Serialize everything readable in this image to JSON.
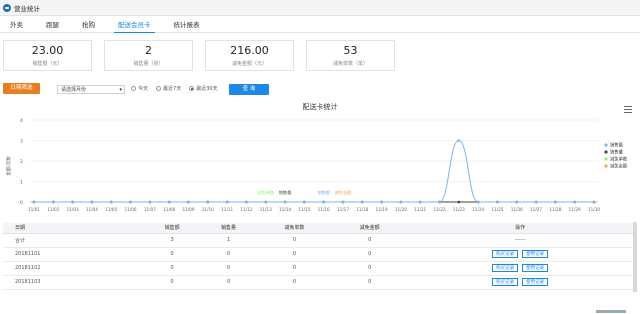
{
  "app": {
    "title": "营业统计"
  },
  "tabs": [
    {
      "label": "外卖"
    },
    {
      "label": "跑腿"
    },
    {
      "label": "抢购"
    },
    {
      "label": "配送会员卡",
      "active": true
    },
    {
      "label": "统计报表"
    }
  ],
  "cards": [
    {
      "value": "23.00",
      "label": "销售额（元）"
    },
    {
      "value": "2",
      "label": "销售量（张）"
    },
    {
      "value": "216.00",
      "label": "减免金额（元）"
    },
    {
      "value": "53",
      "label": "减免单数（单）"
    }
  ],
  "filter": {
    "button": "日期筛选",
    "select": "请选择月份",
    "options": [
      "今天",
      "最近7天",
      "最近30天"
    ],
    "selected": "最近30天",
    "query": "查 询"
  },
  "chart_data": {
    "type": "line",
    "title": "配送卡统计",
    "ylabel": "金额/次数",
    "ylim": [
      0,
      4
    ],
    "yticks": [
      0,
      1,
      2,
      3,
      4
    ],
    "categories": [
      "11/01",
      "11/02",
      "11/03",
      "11/04",
      "11/05",
      "11/06",
      "11/07",
      "11/08",
      "11/09",
      "11/10",
      "11/11",
      "11/12",
      "11/13",
      "11/14",
      "11/15",
      "11/16",
      "11/17",
      "11/18",
      "11/19",
      "11/20",
      "11/21",
      "11/22",
      "11/23",
      "11/24",
      "11/25",
      "11/26",
      "11/27",
      "11/28",
      "11/29",
      "11/30"
    ],
    "series": [
      {
        "name": "销售额",
        "color": "#7cb5ec",
        "values": [
          0,
          0,
          0,
          0,
          0,
          0,
          0,
          0,
          0,
          0,
          0,
          0,
          0,
          0,
          0,
          0,
          0,
          0,
          0,
          0,
          0,
          0,
          3,
          0,
          0,
          0,
          0,
          0,
          0,
          0
        ]
      },
      {
        "name": "销售量",
        "color": "#434348",
        "values": [
          0,
          0,
          0,
          0,
          0,
          0,
          0,
          0,
          0,
          0,
          0,
          0,
          0,
          0,
          0,
          0,
          0,
          0,
          0,
          0,
          0,
          0,
          0,
          0,
          0,
          0,
          0,
          0,
          0,
          0
        ]
      },
      {
        "name": "减免单数",
        "color": "#90ed7d",
        "values": [
          0,
          0,
          0,
          0,
          0,
          0,
          0,
          0,
          0,
          0,
          0,
          0,
          0,
          0,
          0,
          0,
          0,
          0,
          0,
          0,
          0,
          0,
          0,
          0,
          0,
          0,
          0,
          0,
          0,
          0
        ]
      },
      {
        "name": "减免金额",
        "color": "#f7a35c",
        "values": [
          0,
          0,
          0,
          0,
          0,
          0,
          0,
          0,
          0,
          0,
          0,
          0,
          0,
          0,
          0,
          0,
          0,
          0,
          0,
          0,
          0,
          0,
          0,
          0,
          0,
          0,
          0,
          0,
          0,
          0
        ]
      }
    ],
    "annotations": [
      {
        "text": "减免单数",
        "x": "11/13",
        "color": "#90ed7d"
      },
      {
        "text": "销售量",
        "x": "11/14",
        "color": "#434348"
      },
      {
        "text": "销售额",
        "x": "11/16",
        "color": "#7cb5ec"
      },
      {
        "text": "减免金额",
        "x": "11/17",
        "color": "#f7a35c"
      }
    ],
    "legend": "right"
  },
  "table": {
    "headers": [
      "日期",
      "销售额",
      "销售量",
      "减免单数",
      "减免金额",
      "操作"
    ],
    "total": {
      "date": "合计",
      "sales": "3",
      "qty": "1",
      "count": "0",
      "amount": "0",
      "op": "------"
    },
    "rows": [
      {
        "date": "20181101",
        "sales": "0",
        "qty": "0",
        "count": "0",
        "amount": "0"
      },
      {
        "date": "20181102",
        "sales": "0",
        "qty": "0",
        "count": "0",
        "amount": "0"
      },
      {
        "date": "20181103",
        "sales": "0",
        "qty": "0",
        "count": "0",
        "amount": "0"
      }
    ],
    "buy_record": "购买记录",
    "use_record": "使用记录"
  }
}
